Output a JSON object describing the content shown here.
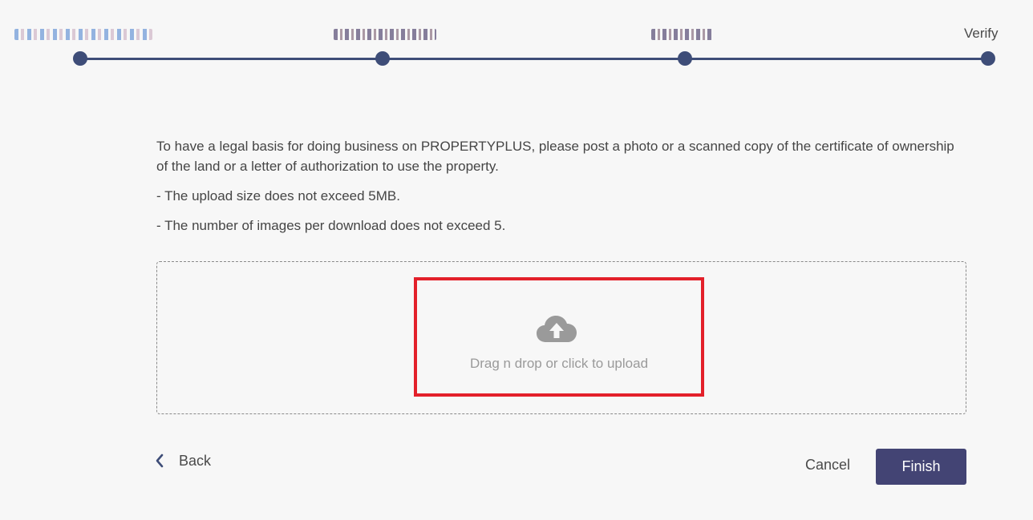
{
  "stepper": {
    "steps": [
      {
        "label": "",
        "blurred": true
      },
      {
        "label": "",
        "blurred": true
      },
      {
        "label": "",
        "blurred": true
      },
      {
        "label": "Verify",
        "blurred": false
      }
    ]
  },
  "instructions": {
    "paragraph": "To have a legal basis for doing business on PROPERTYPLUS, please post a photo or a scanned copy of the certificate of ownership of the land or a letter of authorization to use the property.",
    "rule_size": "- The upload size does not exceed 5MB.",
    "rule_count": "- The number of images per download does not exceed 5."
  },
  "upload": {
    "text": "Drag n drop or click to upload",
    "icon": "cloud-upload-icon"
  },
  "footer": {
    "back_label": "Back",
    "cancel_label": "Cancel",
    "finish_label": "Finish"
  },
  "colors": {
    "accent": "#3e4d78",
    "button": "#434474",
    "highlight": "#e3202a"
  }
}
